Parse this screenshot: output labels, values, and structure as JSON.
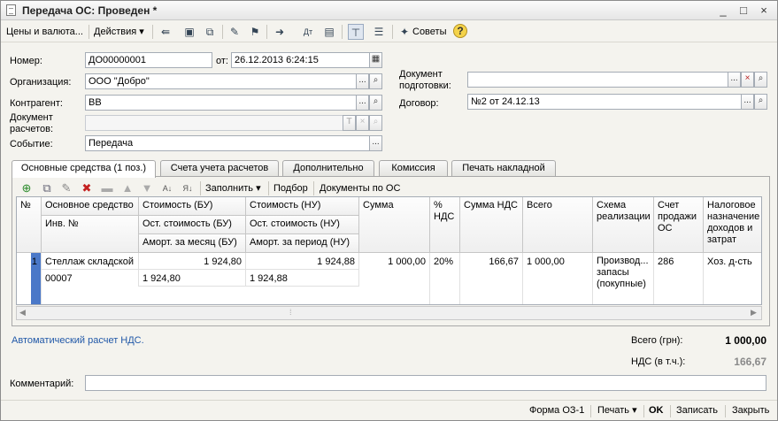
{
  "window": {
    "title": "Передача ОС: Проведен *",
    "controls": [
      "_",
      "□",
      "×"
    ]
  },
  "toolbar": {
    "prices_currency": "Цены и валюта...",
    "actions": "Действия",
    "advice": "Советы"
  },
  "form": {
    "number_label": "Номер:",
    "number_value": "ДО00000001",
    "date_label": "от:",
    "date_value": "26.12.2013  6:24:15",
    "org_label": "Организация:",
    "org_value": "ООО \"Добро\"",
    "contractor_label": "Контрагент:",
    "contractor_value": "ВВ",
    "settlement_doc_label": "Документ расчетов:",
    "settlement_doc_value": "",
    "event_label": "Событие:",
    "event_value": "Передача",
    "prep_doc_label": "Документ подготовки:",
    "prep_doc_value": "",
    "contract_label": "Договор:",
    "contract_value": "№2 от 24.12.13"
  },
  "tabs": [
    "Основные средства (1 поз.)",
    "Счета учета расчетов",
    "Дополнительно",
    "Комиссия",
    "Печать накладной"
  ],
  "grid_toolbar": {
    "fill": "Заполнить",
    "select": "Подбор",
    "os_docs": "Документы по ОС"
  },
  "grid": {
    "headers": {
      "num": "№",
      "asset": "Основное средство",
      "inv": "Инв. №",
      "cost_bu": "Стоимость (БУ)",
      "rest_bu": "Ост. стоимость (БУ)",
      "amort_bu": "Аморт. за месяц (БУ)",
      "cost_nu": "Стоимость (НУ)",
      "rest_nu": "Ост. стоимость (НУ)",
      "amort_nu": "Аморт. за период (НУ)",
      "sum": "Сумма",
      "vat_pct": "% НДС",
      "vat_sum": "Сумма НДС",
      "total": "Всего",
      "scheme": "Схема реализации",
      "sale_acc": "Счет продажи ОС",
      "tax": "Налоговое назначение доходов и затрат"
    },
    "row": {
      "num": "1",
      "asset": "Стеллаж складской",
      "inv": "00007",
      "cost_bu": "1 924,80",
      "rest_bu": "1 924,80",
      "cost_nu": "1 924,88",
      "rest_nu": "1 924,88",
      "sum": "1 000,00",
      "vat_pct": "20%",
      "vat_sum": "166,67",
      "total": "1 000,00",
      "scheme": "Производ... запасы (покупные)",
      "sale_acc": "286",
      "tax": "Хоз. д-сть"
    }
  },
  "footer": {
    "auto_vat_link": "Автоматический расчет НДС.",
    "total_label": "Всего (грн):",
    "total_value": "1 000,00",
    "vat_label": "НДС (в т.ч.):",
    "vat_value": "166,67",
    "comment_label": "Комментарий:",
    "comment_value": ""
  },
  "bottom": {
    "form_o3": "Форма ОЗ-1",
    "print": "Печать",
    "ok": "OK",
    "save": "Записать",
    "close": "Закрыть"
  },
  "colors": {
    "accent_link": "#2158a8",
    "row_marker": "#4a78c8",
    "vat_value_gray": "#8a8a8a"
  }
}
